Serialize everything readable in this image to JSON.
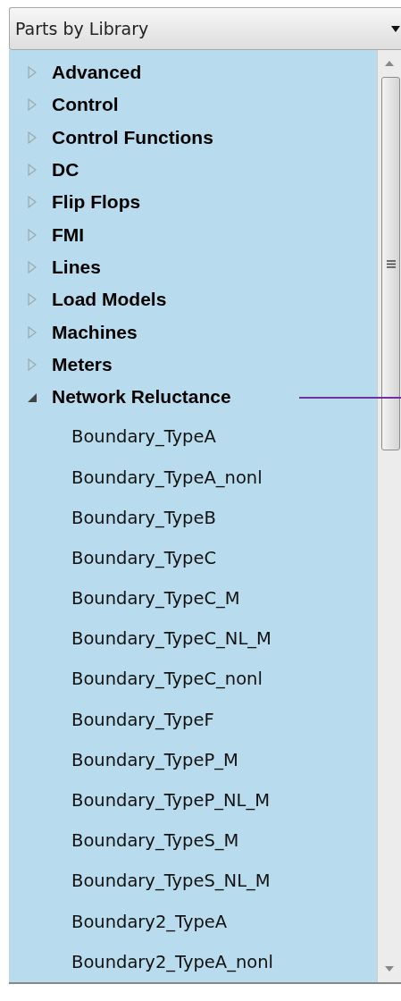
{
  "dropdown": {
    "value": "Parts by Library"
  },
  "tree": [
    {
      "label": "Advanced",
      "expanded": false
    },
    {
      "label": "Control",
      "expanded": false
    },
    {
      "label": "Control Functions",
      "expanded": false
    },
    {
      "label": "DC",
      "expanded": false
    },
    {
      "label": "Flip Flops",
      "expanded": false
    },
    {
      "label": "FMI",
      "expanded": false
    },
    {
      "label": "Lines",
      "expanded": false
    },
    {
      "label": "Load Models",
      "expanded": false
    },
    {
      "label": "Machines",
      "expanded": false
    },
    {
      "label": "Meters",
      "expanded": false
    },
    {
      "label": "Network Reluctance",
      "expanded": true,
      "children": [
        {
          "label": "Boundary_TypeA"
        },
        {
          "label": "Boundary_TypeA_nonl"
        },
        {
          "label": "Boundary_TypeB"
        },
        {
          "label": "Boundary_TypeC"
        },
        {
          "label": "Boundary_TypeC_M"
        },
        {
          "label": "Boundary_TypeC_NL_M"
        },
        {
          "label": "Boundary_TypeC_nonl"
        },
        {
          "label": "Boundary_TypeF"
        },
        {
          "label": "Boundary_TypeP_M"
        },
        {
          "label": "Boundary_TypeP_NL_M"
        },
        {
          "label": "Boundary_TypeS_M"
        },
        {
          "label": "Boundary_TypeS_NL_M"
        },
        {
          "label": "Boundary2_TypeA"
        },
        {
          "label": "Boundary2_TypeA_nonl"
        }
      ]
    }
  ]
}
